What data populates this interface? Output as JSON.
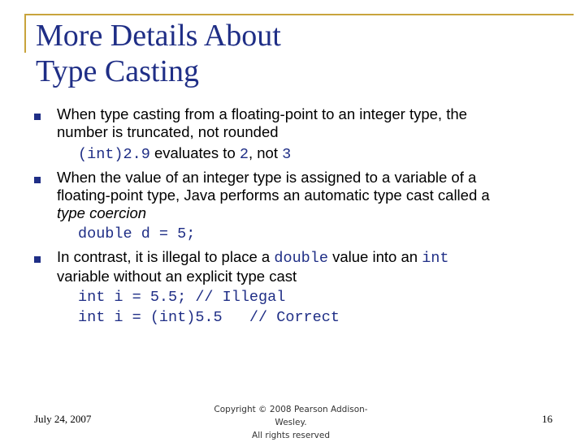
{
  "title": {
    "line1": "More Details About",
    "line2": "Type Casting"
  },
  "bullets": [
    {
      "line1": "When type casting from a floating-point to an integer type, the",
      "line2": "number is truncated, not rounded",
      "example": {
        "code1": "(int)2.9",
        "text1": " evaluates to ",
        "code2": "2",
        "text2": ", not ",
        "code3": "3"
      }
    },
    {
      "line1": "When the value of an integer type is assigned to a variable of a",
      "line2": "floating-point type, Java performs an automatic type cast called a",
      "line3": "type coercion",
      "code": "double d = 5;"
    },
    {
      "line1_a": "In contrast, it is illegal to place a ",
      "line1_code1": "double",
      "line1_b": " value into an ",
      "line1_code2": "int",
      "line2": "variable without an explicit type cast",
      "code1": "int i = 5.5; // Illegal",
      "code2": "int i = (int)5.5   // Correct"
    }
  ],
  "footer": {
    "date": "July 24, 2007",
    "copyright_line1": "Copyright © 2008 Pearson Addison-Wesley.",
    "copyright_line2": "All rights reserved",
    "page": "16"
  },
  "colors": {
    "accent": "#c8a43c",
    "title": "#1f2e86",
    "bullet": "#1f2e86",
    "code": "#1f2e86"
  }
}
